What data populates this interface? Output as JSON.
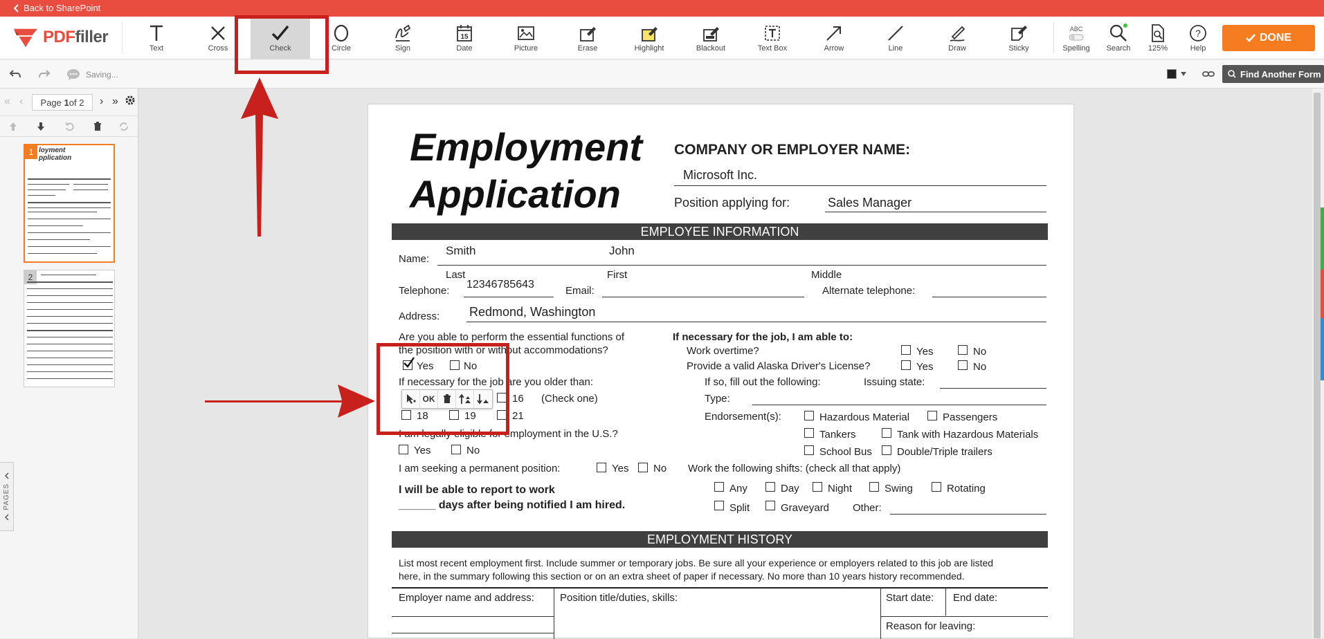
{
  "topbar": {
    "back_label": "Back to SharePoint"
  },
  "logo": {
    "pdf": "PDF",
    "filler": "filler"
  },
  "tools": [
    {
      "label": "Text"
    },
    {
      "label": "Cross"
    },
    {
      "label": "Check"
    },
    {
      "label": "Circle"
    },
    {
      "label": "Sign"
    },
    {
      "label": "Date"
    },
    {
      "label": "Picture"
    },
    {
      "label": "Erase"
    },
    {
      "label": "Highlight"
    },
    {
      "label": "Blackout"
    },
    {
      "label": "Text Box"
    },
    {
      "label": "Arrow"
    },
    {
      "label": "Line"
    },
    {
      "label": "Draw"
    },
    {
      "label": "Sticky"
    }
  ],
  "right_tools": [
    {
      "label": "Spelling",
      "badge": "ABC"
    },
    {
      "label": "Search"
    },
    {
      "label": "125%"
    },
    {
      "label": "Help"
    }
  ],
  "date_icon_number": "15",
  "done_label": "DONE",
  "subbar": {
    "saving": "Saving...",
    "find_form": "Find Another Form"
  },
  "pager": {
    "page_label_pre": "Page ",
    "page_current": "1",
    "page_label_post": " of 2"
  },
  "thumbs": [
    {
      "num": "1",
      "title_a": "loyment",
      "title_b": "pplication"
    },
    {
      "num": "2"
    }
  ],
  "pages_tab": "PAGES",
  "doc": {
    "title_1": "Employment",
    "title_2": "Application",
    "company_label": "COMPANY OR EMPLOYER NAME:",
    "company_value": "Microsoft Inc.",
    "position_label": "Position applying for:",
    "position_value": "Sales Manager",
    "section_employee": "EMPLOYEE INFORMATION",
    "name_label": "Name:",
    "last_value": "Smith",
    "first_value": "John",
    "last_label": "Last",
    "first_label": "First",
    "middle_label": "Middle",
    "telephone_label": "Telephone:",
    "telephone_value": "12346785643",
    "email_label": "Email:",
    "alt_tel_label": "Alternate telephone:",
    "address_label": "Address:",
    "address_value": "Redmond, Washington",
    "essential_1": "Are you able to perform the essential functions of",
    "essential_2": "the position with or without accommodations?",
    "yes": "Yes",
    "no": "No",
    "older_label": "If necessary for the job are you older than:",
    "age_16": "16",
    "check_one": "(Check one)",
    "age_18": "18",
    "age_19": "19",
    "age_21": "21",
    "legal_label": "I am legally eligible for employment in the U.S.?",
    "permanent_label": "I am seeking a permanent position:",
    "report_1": "I will be able to report to work",
    "report_2": "______ days after being notified I am hired.",
    "able_heading": "If necessary for the job, I am able to:",
    "overtime": "Work overtime?",
    "license": "Provide a valid Alaska Driver's License?",
    "if_so": "If so, fill out the following:",
    "issuing": "Issuing state:",
    "type": "Type:",
    "endorsements": "Endorsement(s):",
    "hazardous": "Hazardous Material",
    "passengers": "Passengers",
    "tankers": "Tankers",
    "tank_haz": "Tank with Hazardous Materials",
    "school_bus": "School Bus",
    "double_triple": "Double/Triple trailers",
    "shifts": "Work the following shifts: (check all that apply)",
    "any": "Any",
    "day": "Day",
    "night": "Night",
    "swing": "Swing",
    "rotating": "Rotating",
    "split": "Split",
    "graveyard": "Graveyard",
    "other": "Other:",
    "section_history": "EMPLOYMENT HISTORY",
    "history_1": "List most recent employment first. Include summer or temporary jobs. Be sure all your experience or employers related to this job are listed",
    "history_2": "here, in the summary following this section or on an extra sheet of paper if necessary. No more than 10 years history recommended.",
    "employer_name": "Employer name and address:",
    "position_title": "Position title/duties, skills:",
    "start_date": "Start date:",
    "end_date": "End date:",
    "reason_leaving": "Reason for leaving:"
  },
  "mini_toolbar": {
    "ok": "OK"
  },
  "colors": {
    "topbar": "#e94d3f",
    "done": "#f57d1f",
    "annotation_red": "#c8201c",
    "section_bar": "#404040"
  }
}
